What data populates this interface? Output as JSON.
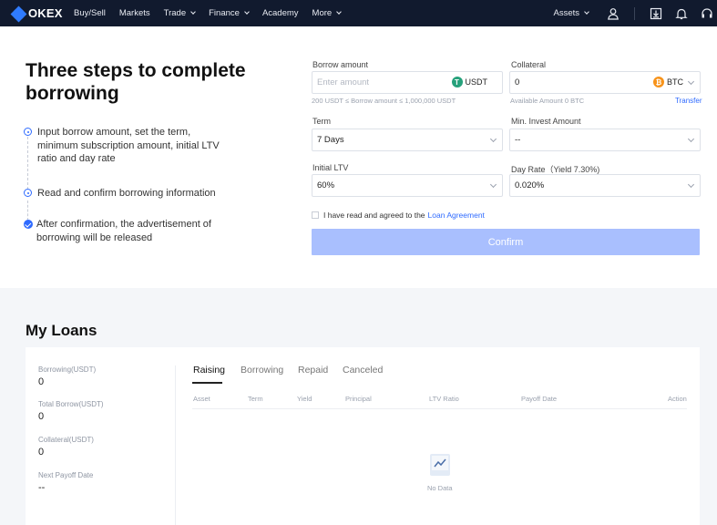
{
  "nav": {
    "brand": "OKEX",
    "items": [
      {
        "label": "Buy/Sell",
        "dropdown": false
      },
      {
        "label": "Markets",
        "dropdown": false
      },
      {
        "label": "Trade",
        "dropdown": true
      },
      {
        "label": "Finance",
        "dropdown": true
      },
      {
        "label": "Academy",
        "dropdown": false
      },
      {
        "label": "More",
        "dropdown": true
      }
    ],
    "assets_label": "Assets",
    "icons": [
      "user-icon",
      "download-icon",
      "bell-icon",
      "headset-icon"
    ]
  },
  "hero": {
    "title": "Three steps to complete borrowing",
    "steps": [
      {
        "text": "Input borrow amount, set the term, minimum subscription amount, initial LTV ratio and day rate",
        "state": "active"
      },
      {
        "text": "Read and confirm borrowing information",
        "state": "active"
      },
      {
        "text": "After confirmation, the advertisement of borrowing will be released",
        "state": "done"
      }
    ]
  },
  "form": {
    "borrow_amount": {
      "label": "Borrow amount",
      "placeholder": "Enter amount",
      "currency": "USDT",
      "hint": "200 USDT ≤ Borrow amount ≤ 1,000,000 USDT"
    },
    "collateral": {
      "label": "Collateral",
      "value": "0",
      "currency": "BTC",
      "hint": "Available Amount 0 BTC",
      "transfer_label": "Transfer"
    },
    "term": {
      "label": "Term",
      "value": "7 Days"
    },
    "min_invest": {
      "label": "Min. Invest Amount",
      "value": "--"
    },
    "initial_ltv": {
      "label": "Initial LTV",
      "value": "60%"
    },
    "day_rate": {
      "label": "Day Rate（Yield 7.30%)",
      "value": "0.020%"
    },
    "agreement_text": "I have read and agreed to the",
    "agreement_link": "Loan Agreement",
    "confirm_label": "Confirm"
  },
  "colors": {
    "nav_bg": "#111a2e",
    "accent": "#2f6bff",
    "confirm_disabled": "#a9bffe",
    "usdt": "#26a17b",
    "btc": "#f7931a"
  },
  "loans": {
    "title": "My Loans",
    "stats": [
      {
        "label": "Borrowing(USDT)",
        "value": "0"
      },
      {
        "label": "Total Borrow(USDT)",
        "value": "0"
      },
      {
        "label": "Collateral(USDT)",
        "value": "0"
      },
      {
        "label": "Next Payoff Date",
        "value": "--"
      }
    ],
    "tabs": [
      "Raising",
      "Borrowing",
      "Repaid",
      "Canceled"
    ],
    "active_tab": "Raising",
    "columns": [
      "Asset",
      "Term",
      "Yield",
      "Principal",
      "LTV Ratio",
      "Payoff Date",
      "Action"
    ],
    "empty_text": "No Data"
  }
}
